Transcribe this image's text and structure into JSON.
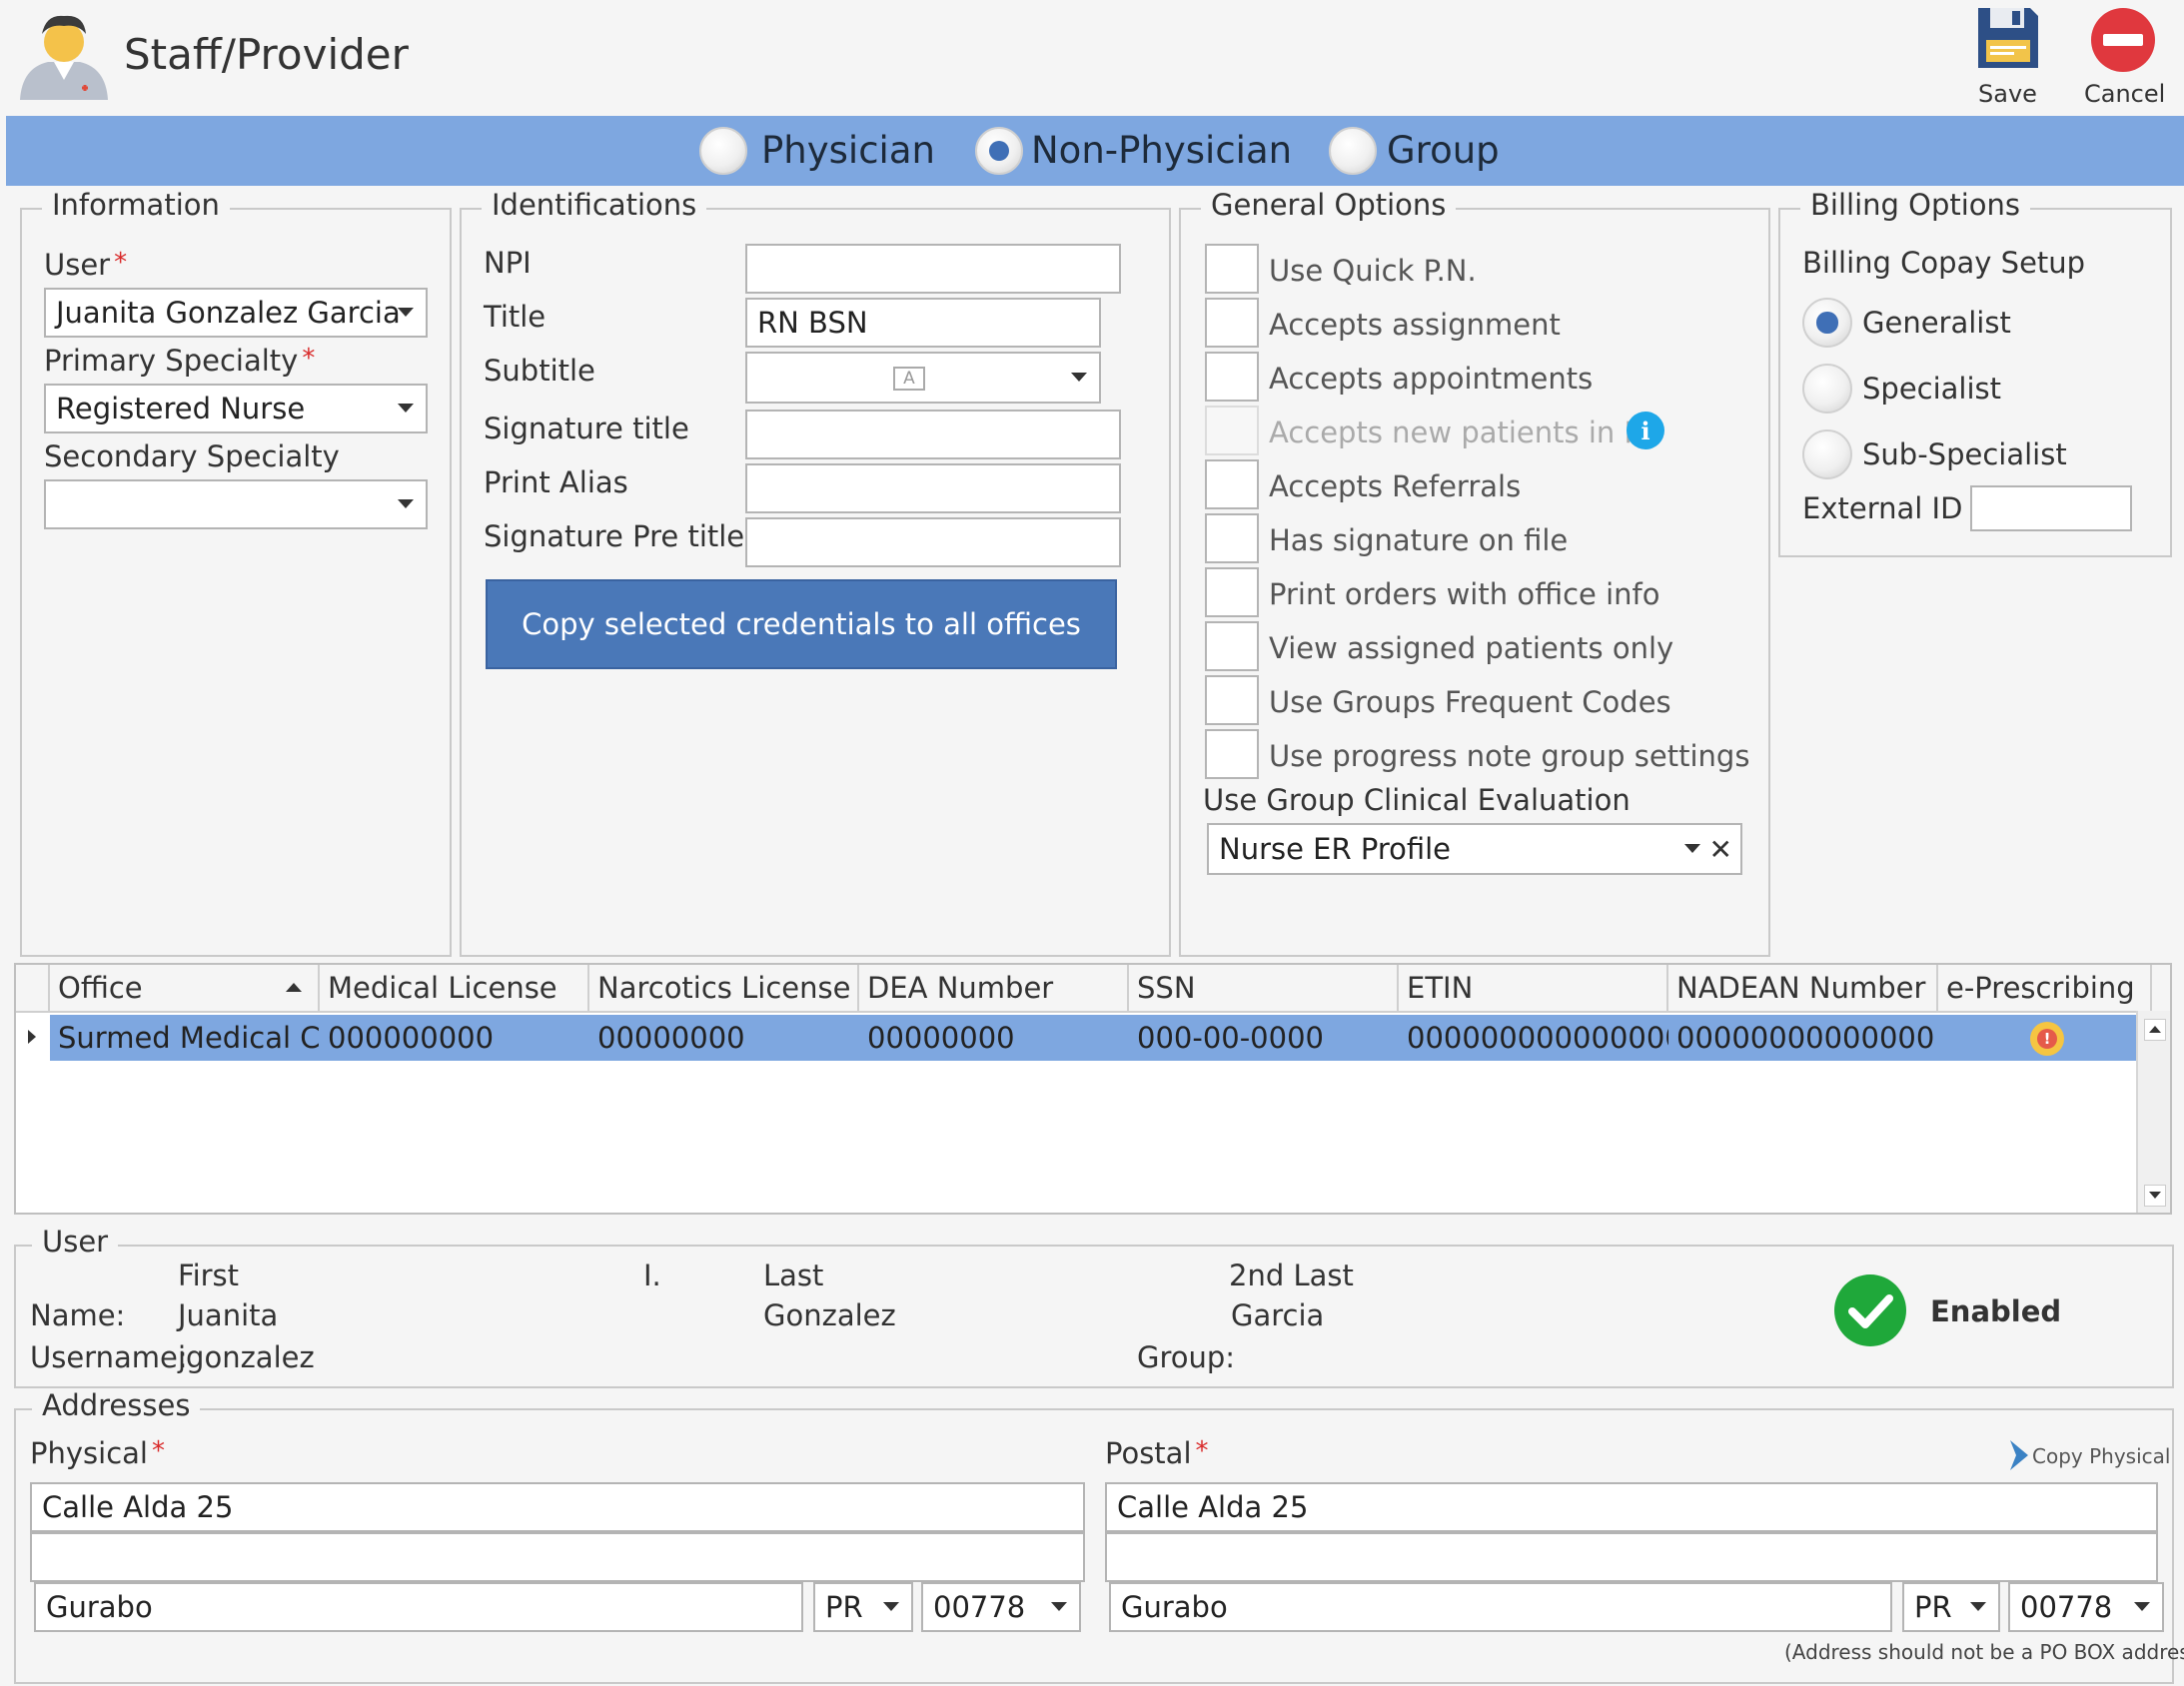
{
  "window": {
    "title": "Staff/Provider"
  },
  "toolbar": {
    "save_label": "Save",
    "cancel_label": "Cancel"
  },
  "provider_type": {
    "options": [
      "Physician",
      "Non-Physician",
      "Group"
    ],
    "selected": "Non-Physician"
  },
  "information": {
    "legend": "Information",
    "user_label": "User",
    "user_value": "Juanita Gonzalez Garcia",
    "primary_specialty_label": "Primary Specialty",
    "primary_specialty_value": "Registered Nurse",
    "secondary_specialty_label": "Secondary Specialty",
    "secondary_specialty_value": ""
  },
  "identifications": {
    "legend": "Identifications",
    "npi_label": "NPI",
    "npi_value": "",
    "title_label": "Title",
    "title_value": "RN BSN",
    "subtitle_label": "Subtitle",
    "subtitle_value": "",
    "signature_title_label": "Signature title",
    "signature_title_value": "",
    "print_alias_label": "Print Alias",
    "print_alias_value": "",
    "signature_pre_title_label": "Signature Pre title",
    "signature_pre_title_value": "",
    "copy_button": "Copy selected credentials to all offices"
  },
  "general_options": {
    "legend": "General Options",
    "options": [
      {
        "label": "Use Quick P.N.",
        "checked": false,
        "disabled": false
      },
      {
        "label": "Accepts assignment",
        "checked": false,
        "disabled": false
      },
      {
        "label": "Accepts appointments",
        "checked": false,
        "disabled": false
      },
      {
        "label": "Accepts new patients in PP",
        "checked": false,
        "disabled": true
      },
      {
        "label": "Accepts Referrals",
        "checked": false,
        "disabled": false
      },
      {
        "label": "Has signature on file",
        "checked": false,
        "disabled": false
      },
      {
        "label": "Print orders with office info",
        "checked": false,
        "disabled": false
      },
      {
        "label": "View assigned patients only",
        "checked": false,
        "disabled": false
      },
      {
        "label": "Use Groups Frequent Codes",
        "checked": false,
        "disabled": false
      },
      {
        "label": "Use progress note group settings",
        "checked": false,
        "disabled": false
      }
    ],
    "clinical_eval_label": "Use Group Clinical Evaluation",
    "clinical_eval_value": "Nurse ER Profile"
  },
  "billing_options": {
    "legend": "Billing Options",
    "copay_label": "Billing Copay Setup",
    "copay_options": [
      "Generalist",
      "Specialist",
      "Sub-Specialist"
    ],
    "copay_selected": "Generalist",
    "external_id_label": "External ID",
    "external_id_value": ""
  },
  "offices_table": {
    "columns": [
      "Office",
      "Medical License",
      "Narcotics License",
      "DEA Number",
      "SSN",
      "ETIN",
      "NADEAN Number",
      "e-Prescribing"
    ],
    "sort_column": "Office",
    "sort_direction": "ascending",
    "rows": [
      {
        "office": "Surmed Medical C...",
        "medical_license": "000000000",
        "narcotics_license": "00000000",
        "dea_number": "00000000",
        "ssn": "000-00-0000",
        "etin": "000000000000000...",
        "nadean_number": "00000000000000",
        "e_prescribing": "warning-icon"
      }
    ]
  },
  "user_section": {
    "legend": "User",
    "first_header": "First",
    "initial_header": "I.",
    "last_header": "Last",
    "second_last_header": "2nd Last",
    "name_label": "Name:",
    "first": "Juanita",
    "initial": "",
    "last": "Gonzalez",
    "second_last": "Garcia",
    "username_label": "Username:",
    "username": "jgonzalez",
    "group_label": "Group:",
    "group": "",
    "status": "Enabled",
    "status_color": "#1fa83a"
  },
  "addresses": {
    "legend": "Addresses",
    "physical_label": "Physical",
    "postal_label": "Postal",
    "copy_physical": "Copy Physical",
    "physical": {
      "line1": "Calle Alda 25",
      "line2": "",
      "city": "Gurabo",
      "state": "PR",
      "zip": "00778"
    },
    "postal": {
      "line1": "Calle Alda 25",
      "line2": "",
      "city": "Gurabo",
      "state": "PR",
      "zip": "00778"
    },
    "note": "(Address should not be a PO BOX address)"
  },
  "colors": {
    "accent_bar": "#7ea7e0",
    "primary_button": "#4a78b8",
    "selected_row": "#7ea7e0",
    "cancel_red": "#e0383e",
    "info_blue": "#1ea7e8"
  }
}
